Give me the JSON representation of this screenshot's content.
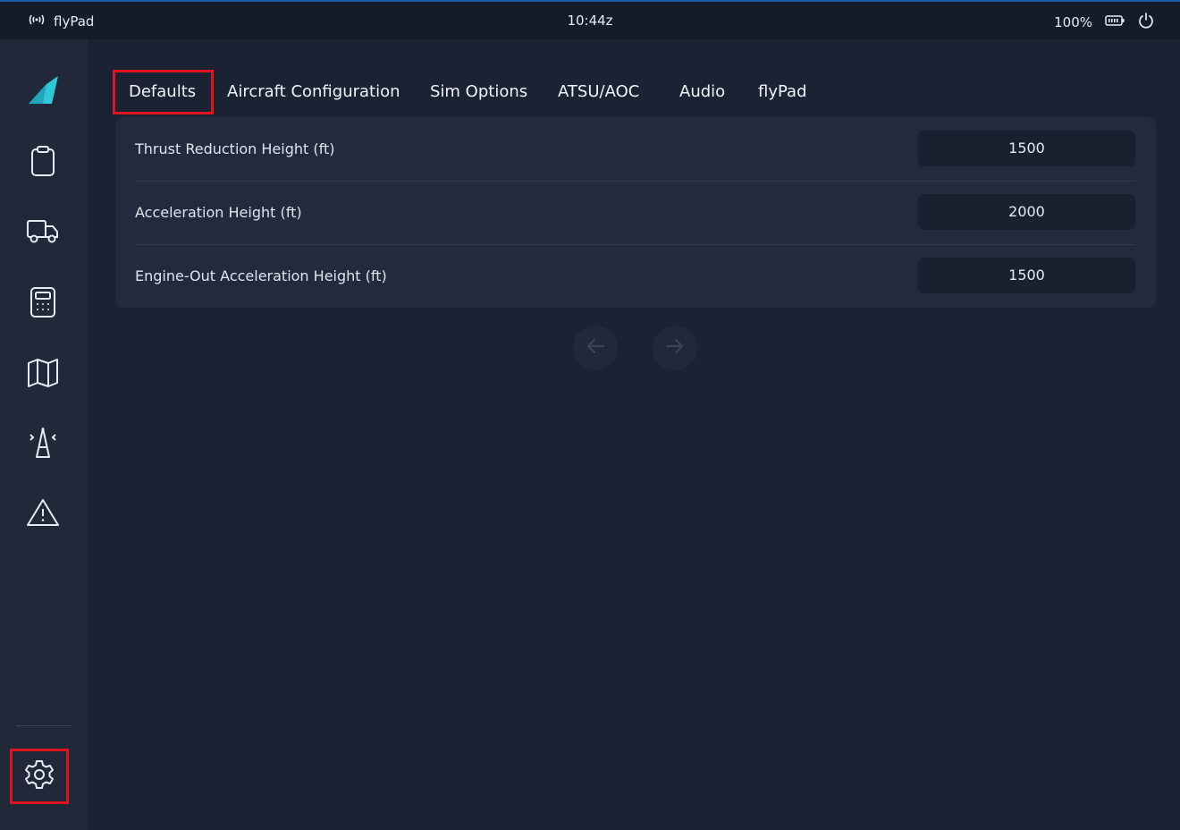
{
  "status_bar": {
    "app_name": "flyPad",
    "time": "10:44z",
    "battery": "100%"
  },
  "sidebar": {
    "items": [
      {
        "name": "logo",
        "icon": "flybywire-logo-icon"
      },
      {
        "name": "dispatch",
        "icon": "clipboard-icon"
      },
      {
        "name": "ground",
        "icon": "truck-icon"
      },
      {
        "name": "performance",
        "icon": "calculator-icon"
      },
      {
        "name": "navigation",
        "icon": "map-icon"
      },
      {
        "name": "atc",
        "icon": "broadcast-tower-icon"
      },
      {
        "name": "failures",
        "icon": "warning-triangle-icon"
      },
      {
        "name": "settings",
        "icon": "gear-icon"
      }
    ]
  },
  "tabs": [
    {
      "label": "Defaults",
      "active": true
    },
    {
      "label": "Aircraft Configuration"
    },
    {
      "label": "Sim Options"
    },
    {
      "label": "ATSU/AOC"
    },
    {
      "label": "Audio"
    },
    {
      "label": "flyPad"
    }
  ],
  "settings": [
    {
      "label": "Thrust Reduction Height (ft)",
      "value": "1500"
    },
    {
      "label": "Acceleration Height (ft)",
      "value": "2000"
    },
    {
      "label": "Engine-Out Acceleration Height (ft)",
      "value": "1500"
    }
  ],
  "colors": {
    "highlight": "#e0141c",
    "logo": "#2fc8d8",
    "background": "#1b2234"
  }
}
